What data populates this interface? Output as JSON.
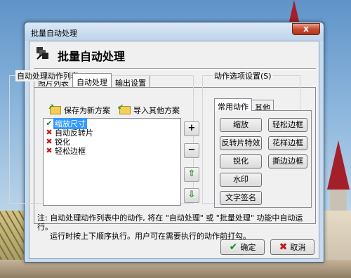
{
  "window": {
    "title": "批量自动处理",
    "close_label": "x"
  },
  "header": {
    "title": "批量自动处理"
  },
  "tabs": [
    {
      "label": "照片列表"
    },
    {
      "label": "自动处理"
    },
    {
      "label": "输出设置"
    }
  ],
  "left_group": {
    "label": "自动处理动作列表",
    "save_label": "保存为新方案",
    "import_label": "导入其他方案",
    "items": [
      {
        "label": "缩放尺寸",
        "enabled": true
      },
      {
        "label": "自动反转片",
        "enabled": false
      },
      {
        "label": "锐化",
        "enabled": false
      },
      {
        "label": "轻松边框",
        "enabled": false
      }
    ],
    "buttons": {
      "add": "+",
      "remove": "−",
      "up": "⇧",
      "down": "⇩"
    }
  },
  "right_group": {
    "label": "动作选项设置(S)",
    "tabs": [
      {
        "label": "常用动作"
      },
      {
        "label": "其他"
      }
    ],
    "actions": [
      {
        "label": "缩放"
      },
      {
        "label": "轻松边框"
      },
      {
        "label": "反转片特效"
      },
      {
        "label": "花样边框"
      },
      {
        "label": "锐化"
      },
      {
        "label": "撕边边框"
      },
      {
        "label": "水印"
      },
      {
        "label": "文字签名"
      }
    ]
  },
  "note": {
    "line1": "注: 自动处理动作列表中的动作, 将在 \"自动处理\" 或 \"批量处理\" 功能中自动运行。",
    "line2": "运行时按上下顺序执行。用户可在需要执行的动作前打勾。"
  },
  "footer": {
    "ok_label": "确定",
    "cancel_label": "取消"
  },
  "colors": {
    "accent_selected": "#3399ff",
    "close": "#c74b32",
    "check": "#1e8a1e",
    "cross": "#c4161c"
  }
}
